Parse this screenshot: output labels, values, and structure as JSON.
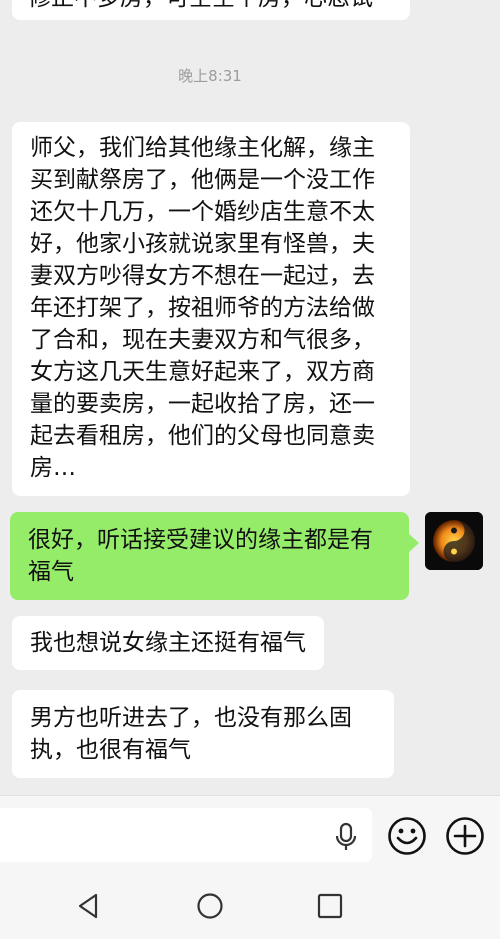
{
  "messages": {
    "top_partial": "修正不多房，可空空个房，心态试",
    "timestamp": "晚上8:31",
    "m1": "师父，我们给其他缘主化解，缘主买到献祭房了，他俩是一个没工作还欠十几万，一个婚纱店生意不太好，他家小孩就说家里有怪兽，夫妻双方吵得女方不想在一起过，去年还打架了，按祖师爷的方法给做了合和，现在夫妻双方和气很多，女方这几天生意好起来了，双方商量的要卖房，一起收拾了房，还一起去看租房，他们的父母也同意卖房…",
    "m2": "很好，听话接受建议的缘主都是有福气",
    "m3": "我也想说女缘主还挺有福气",
    "m4": "男方也听进去了，也没有那么固执，也很有福气"
  },
  "colors": {
    "background": "#ededed",
    "bubble_other": "#ffffff",
    "bubble_mine": "#95ec69",
    "text": "#111111",
    "timestamp": "#9c9c9c"
  },
  "icons": {
    "avatar": "yin-yang-avatar",
    "voice": "microphone-icon",
    "emoji": "smiley-icon",
    "more": "plus-circle-icon",
    "nav_back": "triangle-back-icon",
    "nav_home": "circle-home-icon",
    "nav_recent": "square-recent-icon"
  }
}
